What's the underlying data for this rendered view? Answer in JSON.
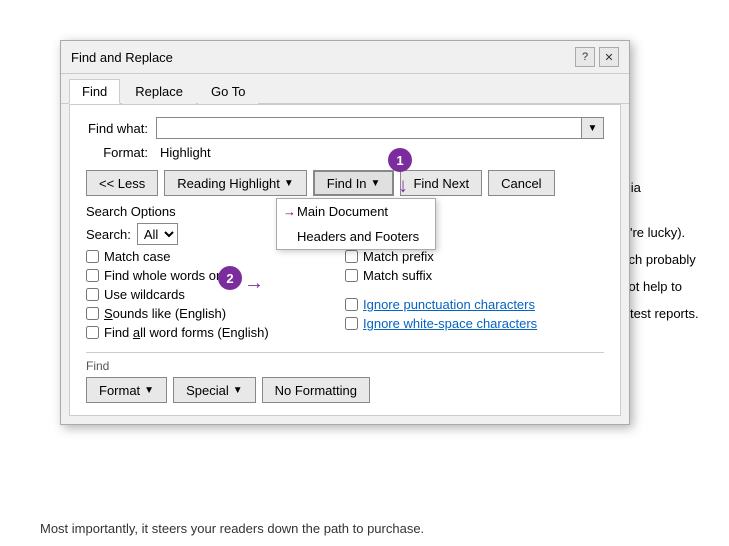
{
  "dialog": {
    "title": "Find and Replace",
    "help_btn": "?",
    "close_btn": "✕",
    "tabs": [
      {
        "label": "Find",
        "active": true
      },
      {
        "label": "Replace",
        "active": false
      },
      {
        "label": "Go To",
        "active": false
      }
    ],
    "find_what_label": "Find what:",
    "find_what_value": "",
    "format_label": "Format:",
    "format_value": "Highlight",
    "buttons": {
      "less": "<< Less",
      "reading_highlight": "Reading Highlight",
      "find_in": "Find In",
      "find_next": "Find Next",
      "cancel": "Cancel"
    },
    "dropdown": {
      "items": [
        {
          "label": "Main Document",
          "arrow": true
        },
        {
          "label": "Headers and Footers",
          "arrow": false
        }
      ]
    },
    "search_options_label": "Search Options",
    "search_label": "Search:",
    "search_value": "All",
    "checkboxes": [
      {
        "label": "Match case",
        "checked": false
      },
      {
        "label": "Find whole words only",
        "checked": false
      },
      {
        "label": "Use wildcards",
        "checked": false
      },
      {
        "label": "Sounds like (English)",
        "checked": false,
        "underline": "S"
      },
      {
        "label": "Find all word forms (English)",
        "checked": false,
        "underline": "a"
      }
    ],
    "right_checkboxes": [
      {
        "label": "Match prefix",
        "checked": false
      },
      {
        "label": "Match suffix",
        "checked": false
      },
      {
        "label": "Ignore punctuation characters",
        "checked": false
      },
      {
        "label": "Ignore white-space characters",
        "checked": false
      }
    ],
    "bottom_section_label": "Find",
    "format_btn": "Format",
    "special_btn": "Special",
    "no_formatting_btn": "No Formatting"
  },
  "annotations": [
    {
      "number": "1"
    },
    {
      "number": "2"
    }
  ],
  "doc_text": {
    "right1": "nedia",
    "right2": "you're lucky).",
    "right3": "which probably",
    "right4": "ill not help to",
    "right5": "e latest reports."
  },
  "bottom_text": "Most importantly, it steers your readers down the path to purchase."
}
